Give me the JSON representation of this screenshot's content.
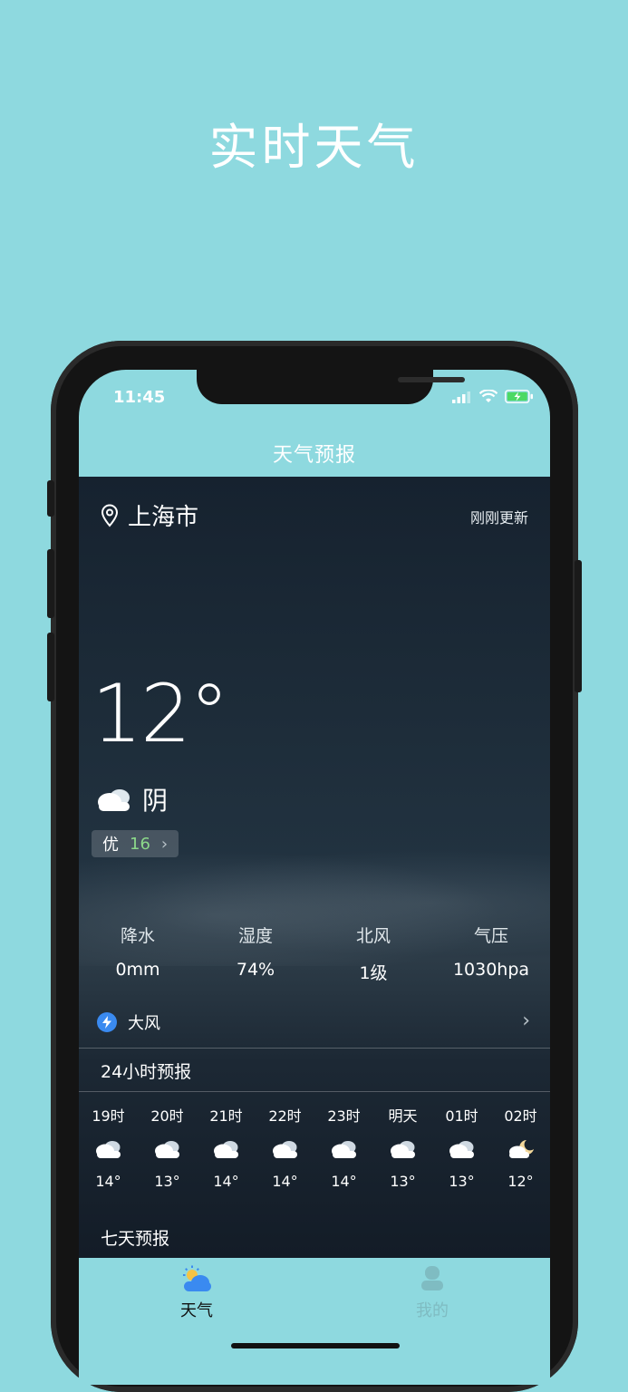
{
  "promo_title": "实时天气",
  "status": {
    "time": "11:45"
  },
  "nav": {
    "title": "天气预报"
  },
  "location": {
    "city": "上海市",
    "updated": "刚刚更新"
  },
  "current": {
    "temp": "12°",
    "condition": "阴",
    "aqi_label": "优",
    "aqi_value": "16"
  },
  "stats": [
    {
      "label": "降水",
      "value": "0mm"
    },
    {
      "label": "湿度",
      "value": "74%"
    },
    {
      "label": "北风",
      "value": "1级"
    },
    {
      "label": "气压",
      "value": "1030hpa"
    }
  ],
  "alert": {
    "text": "大风",
    "icon": "lightning-icon"
  },
  "hourly_title": "24小时预报",
  "hourly": [
    {
      "time": "19时",
      "icon": "cloudy-icon",
      "temp": "14°"
    },
    {
      "time": "20时",
      "icon": "cloudy-icon",
      "temp": "13°"
    },
    {
      "time": "21时",
      "icon": "cloudy-icon",
      "temp": "14°"
    },
    {
      "time": "22时",
      "icon": "cloudy-icon",
      "temp": "14°"
    },
    {
      "time": "23时",
      "icon": "cloudy-icon",
      "temp": "14°"
    },
    {
      "time": "明天",
      "icon": "cloudy-icon",
      "temp": "13°"
    },
    {
      "time": "01时",
      "icon": "cloudy-icon",
      "temp": "13°"
    },
    {
      "time": "02时",
      "icon": "cloudy-night-icon",
      "temp": "12°"
    }
  ],
  "daily_title": "七天预报",
  "tabs": [
    {
      "label": "天气",
      "icon": "weather-tab-icon",
      "active": true
    },
    {
      "label": "我的",
      "icon": "user-tab-icon",
      "active": false
    }
  ],
  "colors": {
    "background": "#8ed9df",
    "aqi_good": "#8cd98a",
    "tab_active": "#111111",
    "tab_inactive": "#7fbcc2"
  }
}
